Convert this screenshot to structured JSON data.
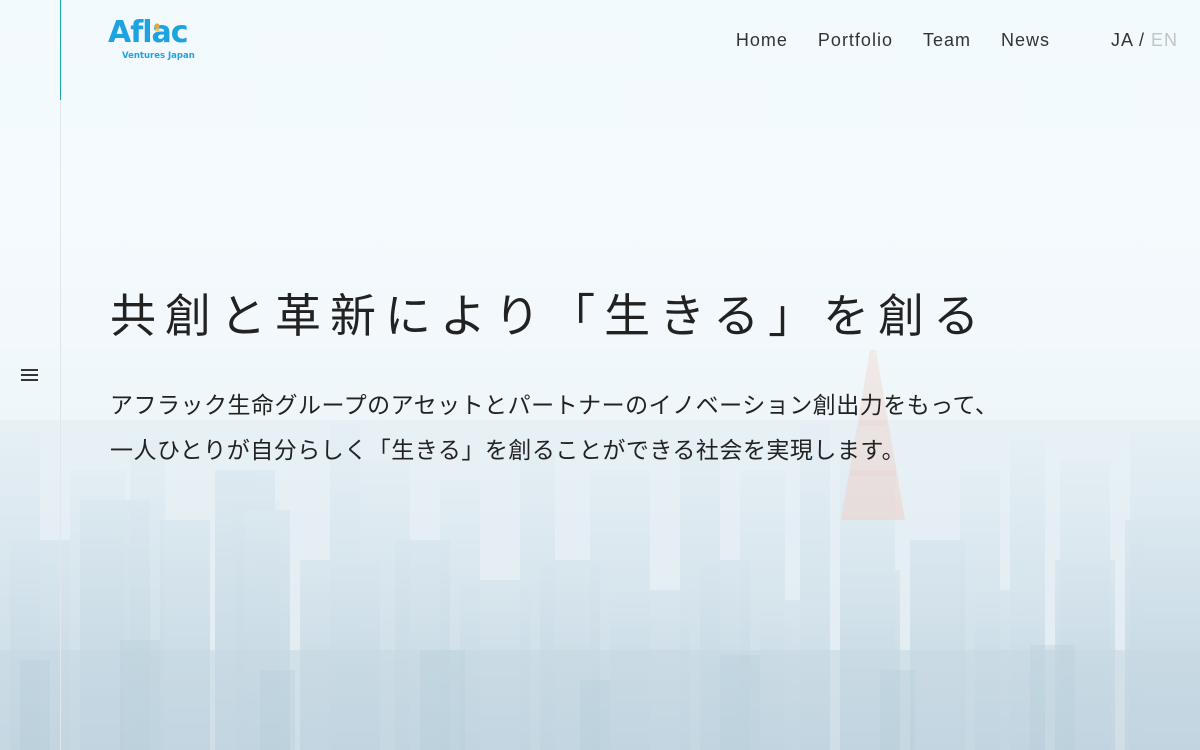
{
  "brand": {
    "logo_main": "Afl·ac",
    "logo_text": "Aflac",
    "logo_sub": "Ventures Japan",
    "brand_color": "#1ea3e2",
    "accent_color": "#1aa3a3"
  },
  "nav": {
    "items": [
      {
        "label": "Home"
      },
      {
        "label": "Portfolio"
      },
      {
        "label": "Team"
      },
      {
        "label": "News"
      }
    ]
  },
  "lang": {
    "ja": "JA",
    "separator": "/",
    "en": "EN",
    "active": "JA"
  },
  "hero": {
    "title": "共創と革新により「生きる」を創る",
    "lead_line1": "アフラック生命グループのアセットとパートナーのイノベーション創出力をもって、",
    "lead_line2": "一人ひとりが自分らしく「生きる」を創ることができる社会を実現します。"
  },
  "menu": {
    "icon": "hamburger-icon"
  }
}
